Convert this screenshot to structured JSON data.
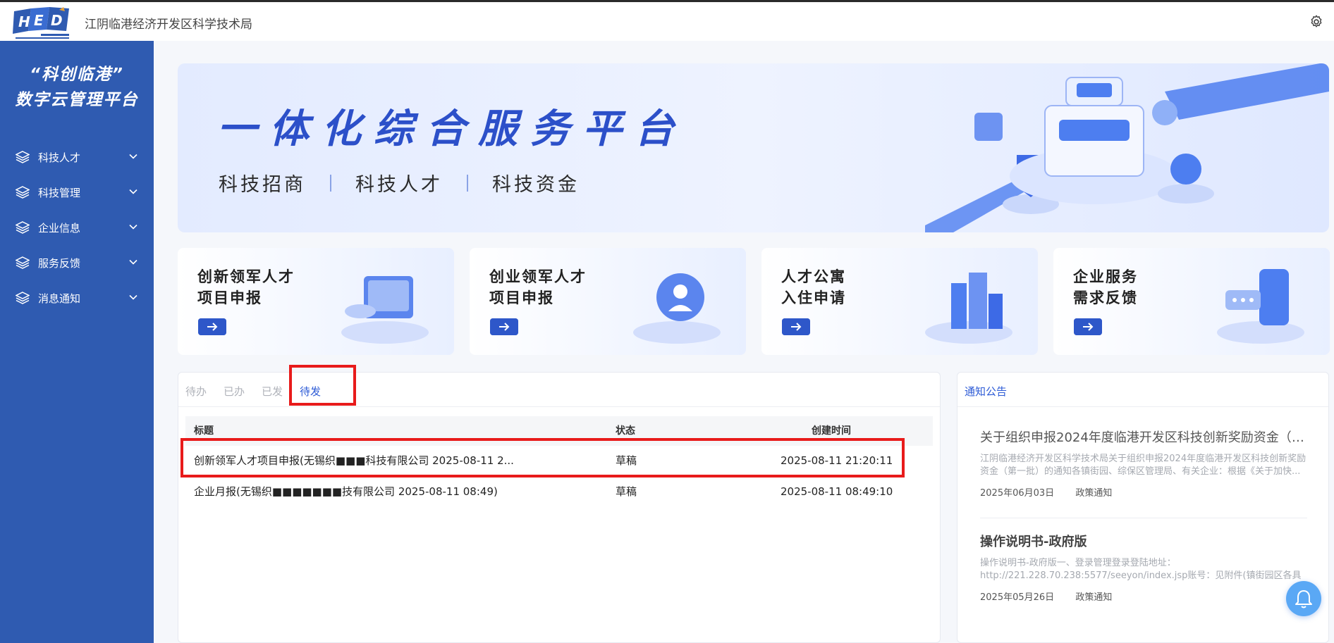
{
  "header": {
    "app_title": "江阴临港经济开发区科学技术局",
    "logo_name": "HEDZ logo",
    "settings_icon": "gear-icon"
  },
  "sidebar": {
    "brand_line1": "“科创临港”",
    "brand_line2": "数字云管理平台",
    "background": "#2f5bb1",
    "items": [
      {
        "label": "科技人才",
        "icon": "layers-icon"
      },
      {
        "label": "科技管理",
        "icon": "layers-icon"
      },
      {
        "label": "企业信息",
        "icon": "layers-icon"
      },
      {
        "label": "服务反馈",
        "icon": "layers-icon"
      },
      {
        "label": "消息通知",
        "icon": "layers-icon"
      }
    ]
  },
  "banner": {
    "title": "一体化综合服务平台",
    "subtitles": [
      "科技招商",
      "科技人才",
      "科技资金"
    ]
  },
  "cards": [
    {
      "title": "创新领军人才\n项目申报",
      "icon": "arrow-right-icon"
    },
    {
      "title": "创业领军人才\n项目申报",
      "icon": "arrow-right-icon"
    },
    {
      "title": "人才公寓\n入住申请",
      "icon": "arrow-right-icon"
    },
    {
      "title": "企业服务\n需求反馈",
      "icon": "arrow-right-icon"
    }
  ],
  "tasks": {
    "tabs": [
      "待办",
      "已办",
      "已发",
      "待发"
    ],
    "active_tab": "待发",
    "columns": {
      "title": "标题",
      "status": "状态",
      "created": "创建时间"
    },
    "rows": [
      {
        "title": "创新领军人才项目申报(无锡织■■■科技有限公司 2025-08-11 2...",
        "status": "草稿",
        "created": "2025-08-11 21:20:11"
      },
      {
        "title": "企业月报(无锡织■■■■■■■技有限公司 2025-08-11 08:49)",
        "status": "草稿",
        "created": "2025-08-11 08:49:10"
      }
    ]
  },
  "notices": {
    "heading": "通知公告",
    "items": [
      {
        "title": "关于组织申报2024年度临港开发区科技创新奖励资金（第...",
        "summary": "江阴临港经济开发区科学技术局关于组织申报2024年度临港开发区科技创新奖励资金（第一批）的通知各镇街园、综保区管理局、有关企业：根据《关于加快...",
        "date": "2025年06月03日",
        "category": "政策通知"
      },
      {
        "title": "操作说明书-政府版",
        "summary": "操作说明书-政府版一、登录管理登录登陆地址：http://221.228.70.238:5577/seeyon/index.jsp账号：见附件(镇街园区各具有两个账号，一个用于流程审批...",
        "date": "2025年05月26日",
        "category": "政策通知"
      }
    ]
  },
  "accent": "#2d5bd6",
  "highlight": "#e81b1b",
  "bell_icon": "bell-icon"
}
